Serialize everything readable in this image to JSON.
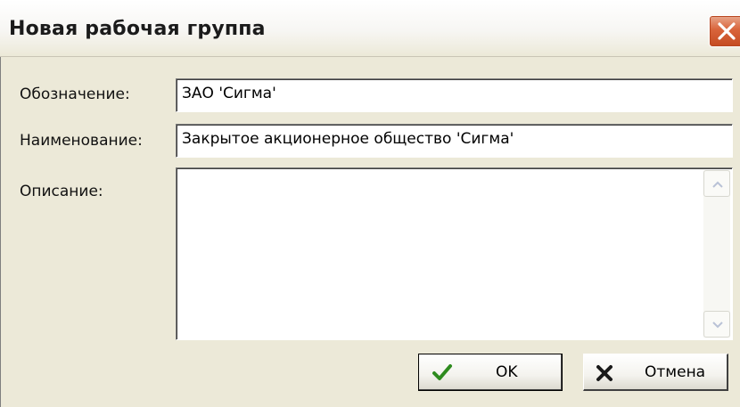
{
  "window": {
    "title": "Новая рабочая группа"
  },
  "form": {
    "designation": {
      "label": "Обозначение:",
      "value": "ЗАО 'Сигма'"
    },
    "name": {
      "label": "Наименование:",
      "value": "Закрытое акционерное общество 'Сигма'"
    },
    "description": {
      "label": "Описание:",
      "value": ""
    }
  },
  "buttons": {
    "ok": {
      "label": "OK",
      "icon": "checkmark-icon"
    },
    "cancel": {
      "label": "Отмена",
      "icon": "cross-icon"
    }
  },
  "colors": {
    "window_background": "#ece9d8",
    "close_button": "#d9643b",
    "ok_icon": "#2e8b1e",
    "cancel_icon": "#1a1a1a"
  }
}
